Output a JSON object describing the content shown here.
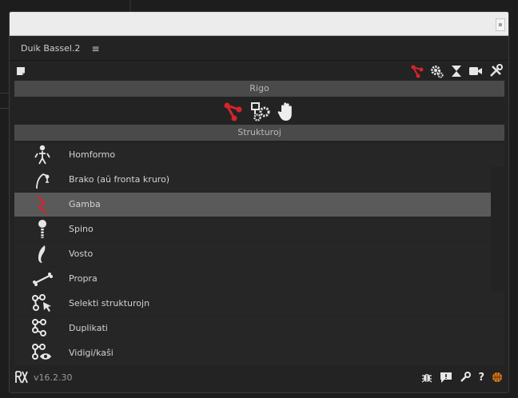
{
  "panel": {
    "title": "Duik Bassel.2",
    "menu_glyph": "≡"
  },
  "toolbar": {
    "left_icon": "note-icon",
    "right_icons": [
      "rigging-icon",
      "automation-gears-icon",
      "constraint-hourglass-icon",
      "camera-icon",
      "tools-icon"
    ]
  },
  "sections": {
    "rigo": "Rigo",
    "strukturoj": "Strukturoj"
  },
  "mode_icons": [
    "bones-icon",
    "links-icon",
    "hand-icon"
  ],
  "list": {
    "items": [
      {
        "label": "Homformo",
        "icon": "skeleton-icon",
        "dot": false,
        "selected": false
      },
      {
        "label": "Brako (aŭ fronta kruro)",
        "icon": "arm-icon",
        "dot": true,
        "selected": false
      },
      {
        "label": "Gamba",
        "icon": "leg-icon",
        "dot": true,
        "selected": true
      },
      {
        "label": "Spino",
        "icon": "spine-icon",
        "dot": true,
        "selected": false
      },
      {
        "label": "Vosto",
        "icon": "tail-icon",
        "dot": true,
        "selected": false
      },
      {
        "label": "Propra",
        "icon": "bone-icon",
        "dot": true,
        "selected": false
      },
      {
        "label": "Selekti strukturojn",
        "icon": "select-structures-icon",
        "dot": false,
        "selected": false
      },
      {
        "label": "Duplikati",
        "icon": "duplicate-icon",
        "dot": false,
        "selected": false
      },
      {
        "label": "Vidigi/kaŝi",
        "icon": "show-hide-icon",
        "dot": false,
        "selected": false
      }
    ]
  },
  "footer": {
    "logo": "RX",
    "version": "v16.2.30",
    "icons": [
      "bug-icon",
      "feedback-icon",
      "settings-wrench-icon",
      "help-icon",
      "basketball-icon"
    ],
    "help_glyph": "?"
  },
  "colors": {
    "accent_red": "#d8232a",
    "selected_row": "#5a5a5a",
    "section_bar": "#4a4a4a",
    "orange": "#e07a1f"
  }
}
